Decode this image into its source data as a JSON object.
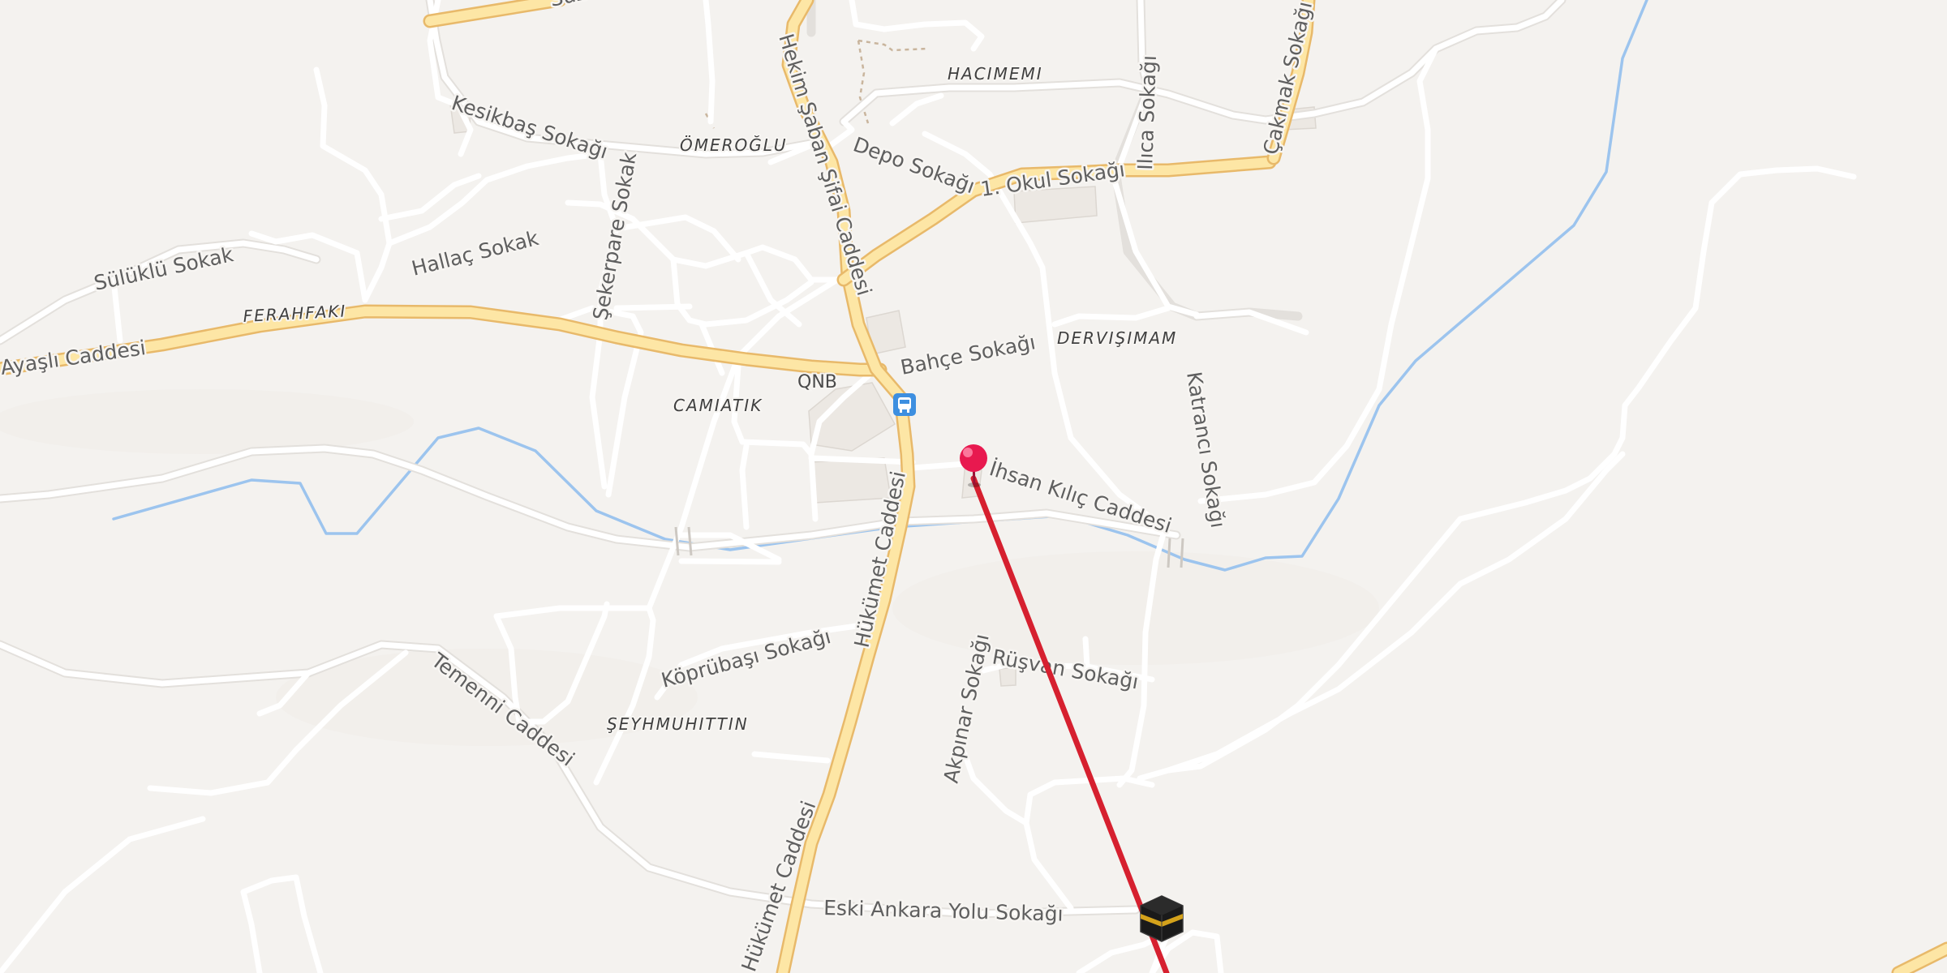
{
  "colors": {
    "background": "#f4f2ef",
    "main_road": "#fde6a5",
    "main_road_casing": "#e8b96a",
    "minor_road": "#ffffff",
    "water": "#9cc4ee",
    "direction_line": "#d6202f",
    "pin": "#e8194f",
    "bus_stop": "#3d8fe0"
  },
  "street_labels": [
    "Suzen",
    "Hekim Şaban Şifai Caddesi",
    "HACIMEMI",
    "Çakmak Sokağı",
    "Kesikbaş Sokağı",
    "ÖMEROĞLU",
    "Depo Sokağı",
    "Ilıca Sokağı",
    "1. Okul Sokağı",
    "Sülüklü Sokak",
    "Hallaç Sokak",
    "Şekerpare Sokak",
    "FERAHFAKI",
    "Ayaşlı Caddesi",
    "DERVIŞIMAM",
    "Bahçe Sokağı",
    "QNB",
    "CAMIATIK",
    "Katrancı Sokağı",
    "İhsan Kılıç Caddesi",
    "Hükümet Caddesi",
    "Köprübaşı Sokağı",
    "Rüşvan Sokağı",
    "Akpınar Sokağı",
    "Temenni Caddesi",
    "ŞEYHMUHITTIN",
    "Eski Ankara Yolu Sokağı",
    "Hükümet Caddesi"
  ],
  "markers": {
    "location_pin": "location-pin-icon",
    "qibla_direction": "kaaba-icon",
    "bus_stop": "bus-stop-icon"
  }
}
